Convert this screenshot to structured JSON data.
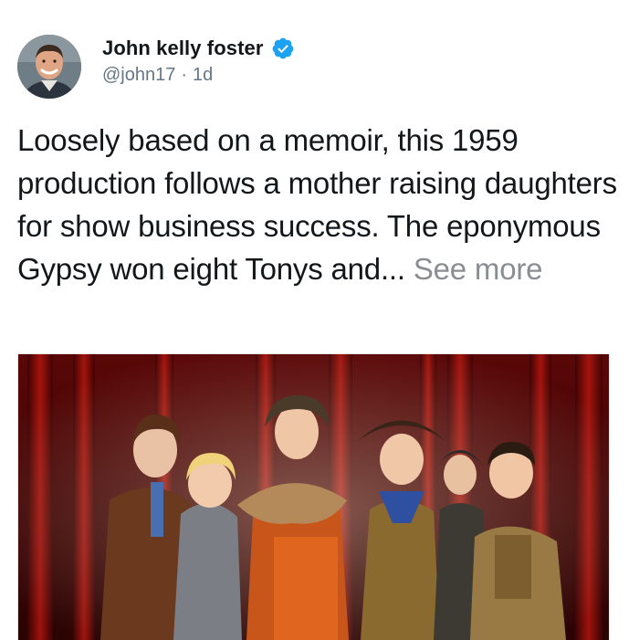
{
  "author": {
    "name": "John kelly foster",
    "handle": "@john17",
    "separator": "·",
    "time": "1d",
    "verified": true
  },
  "tweet": {
    "text": "Loosely based on a memoir, this 1959 production follows a mother raising daughters for show business success. The eponymous Gypsy won eight Tonys and... ",
    "see_more": "See more"
  },
  "colors": {
    "verified_badge": "#1da1f2",
    "meta_text": "#657786",
    "see_more": "#8a8d91",
    "curtain": "#8b0e0e"
  },
  "icons": {
    "verified": "verified-badge-icon",
    "avatar": "user-photo"
  }
}
